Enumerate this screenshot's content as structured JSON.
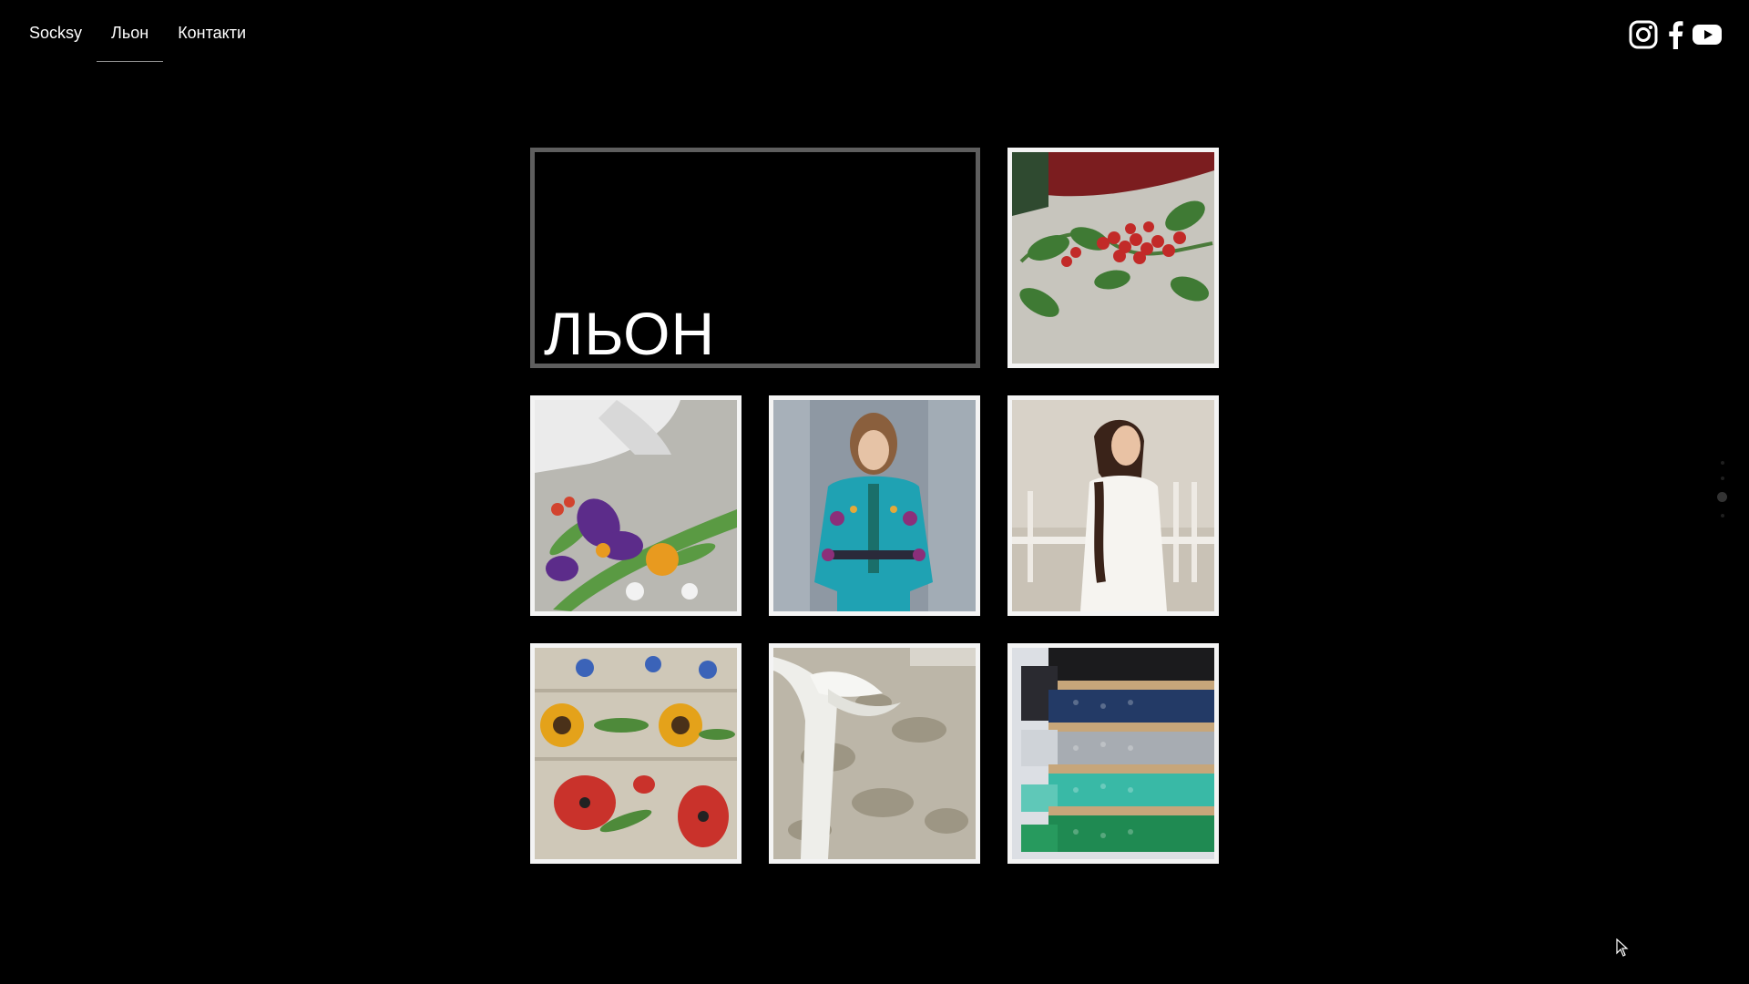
{
  "nav": {
    "items": [
      {
        "label": "Socksy"
      },
      {
        "label": "Льон",
        "active": true
      },
      {
        "label": "Контакти"
      }
    ]
  },
  "social": [
    "instagram-icon",
    "facebook-icon",
    "youtube-icon"
  ],
  "gallery": {
    "title": "ЛЬОН",
    "images": [
      "embroidered-rowan-berries-tablecloth",
      "embroidered-iris-linen",
      "woman-turquoise-embroidered-blouse",
      "woman-white-linen-dress",
      "embroidered-sunflowers-poppies-bands",
      "linen-jacquard-with-ribbon",
      "lace-trim-rolls"
    ]
  },
  "pager": {
    "count": 4,
    "active": 2
  },
  "colors": {
    "background": "#000000",
    "text": "#ffffff",
    "frame": "#f4f4f4",
    "title_frame": "#5e5e5e"
  }
}
